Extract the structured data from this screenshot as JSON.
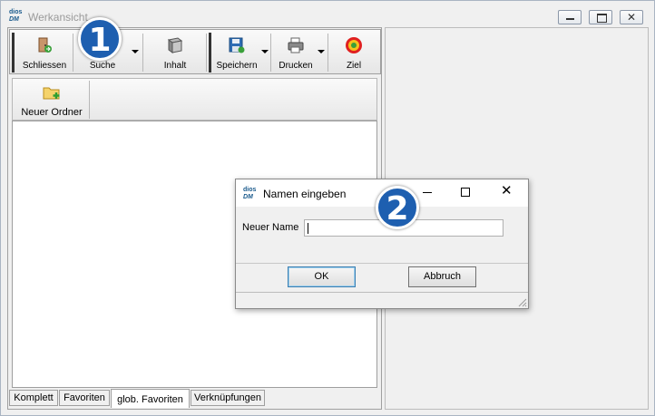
{
  "window": {
    "title": "Werkansicht",
    "logo_text": "dios DM"
  },
  "toolbar": {
    "items": [
      {
        "label": "Schliessen",
        "icon": "door-exit-icon"
      },
      {
        "label": "Suche",
        "icon": "search-icon"
      },
      {
        "label": "Inhalt",
        "icon": "book-icon"
      },
      {
        "label": "Speichern",
        "icon": "floppy-disk-icon"
      },
      {
        "label": "Drucken",
        "icon": "printer-icon"
      },
      {
        "label": "Ziel",
        "icon": "target-icon"
      }
    ]
  },
  "folder_toolbar": {
    "new_folder_label": "Neuer Ordner",
    "icon": "folder-add-icon"
  },
  "tabs": [
    "Komplett",
    "Favoriten",
    "glob. Favoriten",
    "Verknüpfungen"
  ],
  "active_tab_index": 2,
  "callouts": [
    "1",
    "2"
  ],
  "dialog": {
    "title": "Namen eingeben",
    "logo_text": "dios DM",
    "field_label": "Neuer Name",
    "field_value": "",
    "ok_label": "OK",
    "cancel_label": "Abbruch"
  },
  "colors": {
    "callout": "#1e5fb0",
    "title_inactive": "#9a9a9a"
  }
}
